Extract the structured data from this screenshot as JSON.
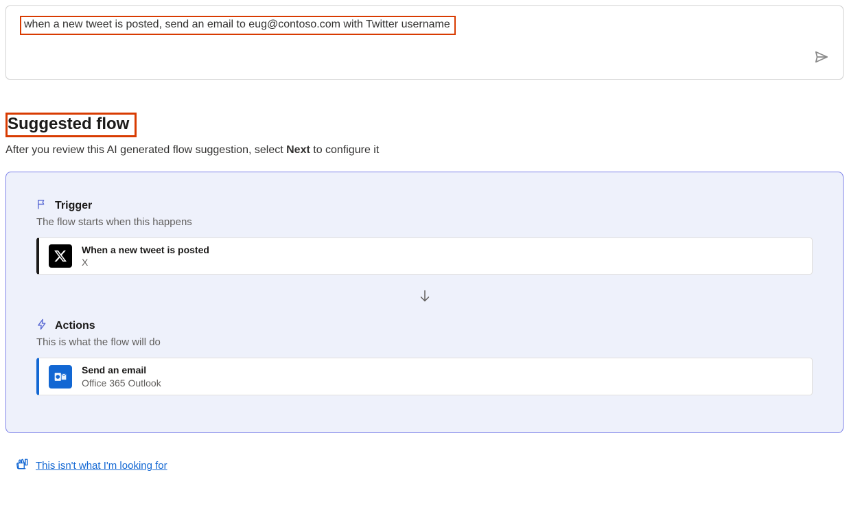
{
  "prompt": {
    "text": "when a new tweet is posted, send an email to eug@contoso.com with Twitter username"
  },
  "heading": "Suggested flow",
  "subtext_prefix": "After you review this AI generated flow suggestion, select ",
  "subtext_bold": "Next",
  "subtext_suffix": " to configure it",
  "trigger": {
    "label": "Trigger",
    "desc": "The flow starts when this happens",
    "step_title": "When a new tweet is posted",
    "step_sub": "X"
  },
  "actions": {
    "label": "Actions",
    "desc": "This is what the flow will do",
    "step_title": "Send an email",
    "step_sub": "Office 365 Outlook"
  },
  "feedback": {
    "link": "This isn't what I'm looking for"
  }
}
